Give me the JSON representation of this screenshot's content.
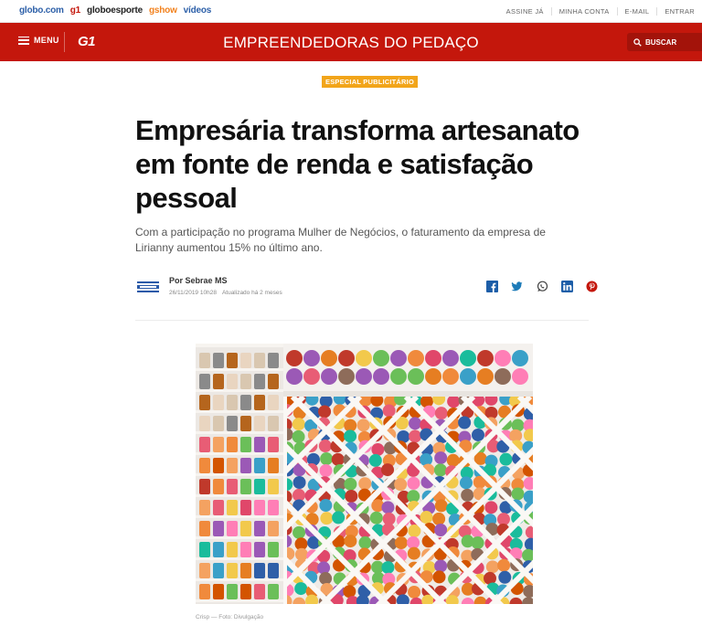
{
  "globobar": {
    "brands": [
      "globo.com",
      "g1",
      "globoesporte",
      "gshow",
      "vídeos"
    ],
    "links": [
      "ASSINE JÁ",
      "MINHA CONTA",
      "E-MAIL",
      "ENTRAR"
    ]
  },
  "header": {
    "menu_label": "MENU",
    "logo": "G1",
    "section_title": "EMPREENDEDORAS DO PEDAÇO",
    "search_label": "BUSCAR",
    "color": "#c4170c"
  },
  "article": {
    "badge": "ESPECIAL PUBLICITÁRIO",
    "title": "Empresária transforma artesanato em fonte de renda e satisfação pessoal",
    "subtitle": "Com a participação no programa Mulher de Negócios, o faturamento da empresa de Lirianny aumentou 15% no último ano.",
    "author": "Por Sebrae MS",
    "date": "26/11/2019 10h28",
    "updated": "Atualizado há 2 meses",
    "caption": "Crisp — Foto: Divulgação"
  },
  "share_icons": [
    "facebook-icon",
    "twitter-icon",
    "whatsapp-icon",
    "linkedin-icon",
    "pinterest-icon"
  ],
  "accent_colors": {
    "badge": "#f2a51a",
    "header": "#c4170c",
    "share": "#1d7bb8",
    "pinterest": "#c4170c"
  }
}
